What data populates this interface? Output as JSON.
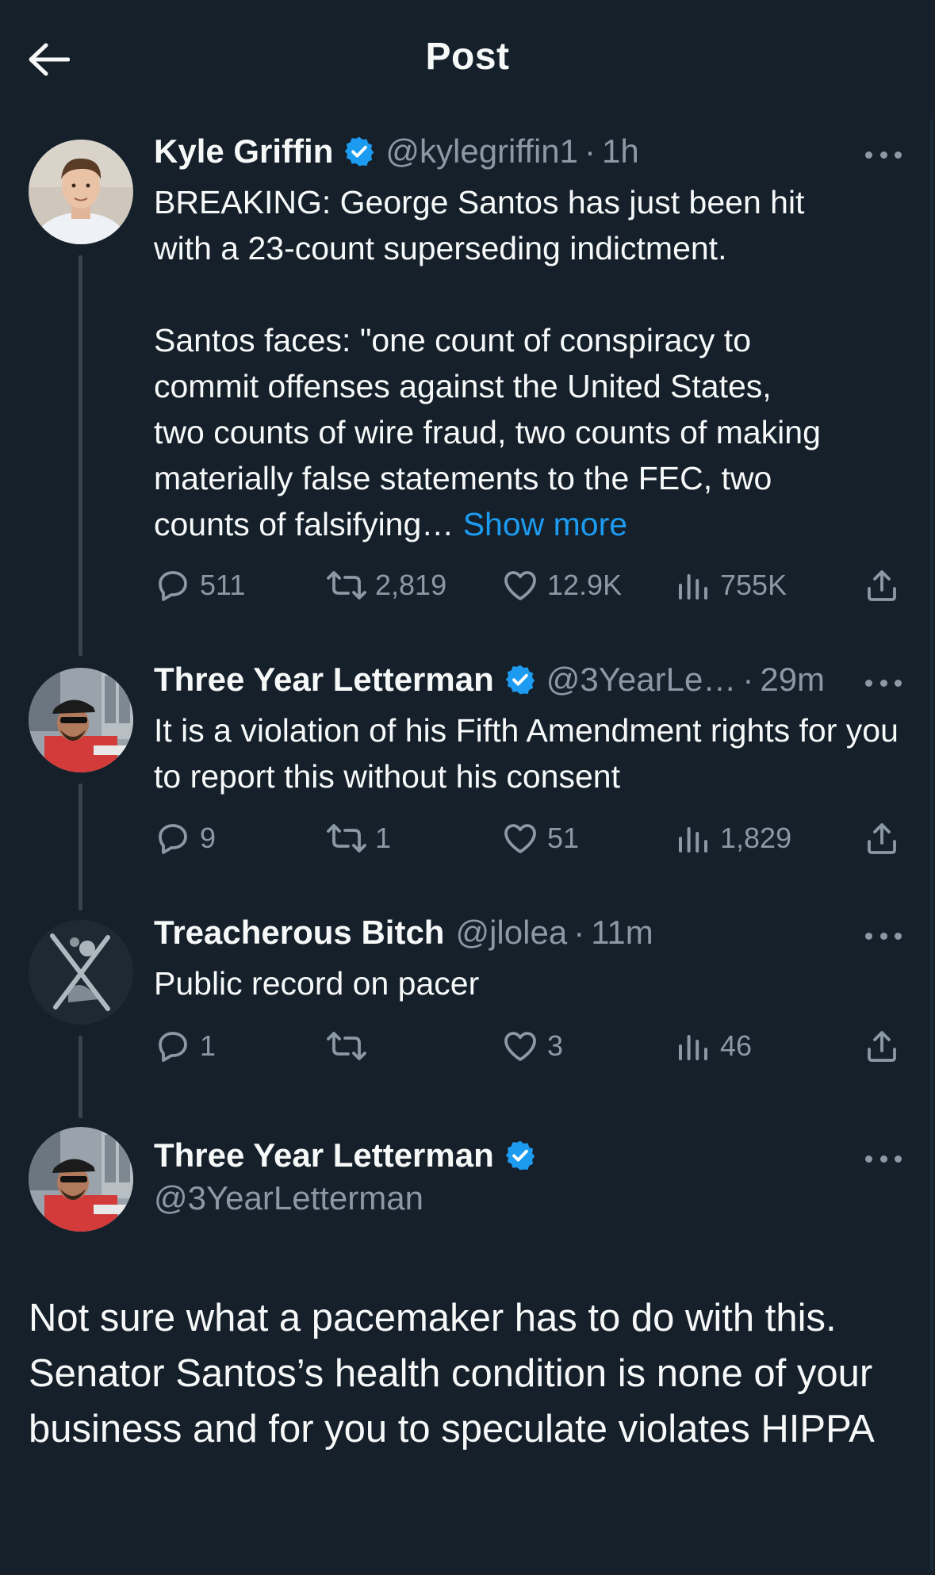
{
  "header": {
    "title": "Post"
  },
  "tweets": [
    {
      "name": "Kyle Griffin",
      "handle": "@kylegriffin1",
      "separator": "·",
      "time": "1h",
      "text": "BREAKING: George Santos has just been hit with a 23-count superseding indictment.\n\nSantos faces: \"one count of conspiracy to commit offenses against the United States, two counts of wire fraud, two counts of making materially false statements to the FEC, two counts of falsifying…",
      "show_more": " Show more",
      "replies": "511",
      "reposts": "2,819",
      "likes": "12.9K",
      "views": "755K"
    },
    {
      "name": "Three Year Letterman",
      "handle": "@3YearLe…",
      "separator": "·",
      "time": "29m",
      "text": "It is a violation of his Fifth Amendment rights for you to report this without his consent",
      "replies": "9",
      "reposts": "1",
      "likes": "51",
      "views": "1,829"
    },
    {
      "name": "Treacherous Bitch",
      "handle": "@jlolea",
      "separator": "·",
      "time": "11m",
      "text": "Public record on pacer",
      "replies": "1",
      "reposts": "",
      "likes": "3",
      "views": "46"
    }
  ],
  "main_post": {
    "name": "Three Year Letterman",
    "handle": "@3YearLetterman",
    "text": "Not sure what a pacemaker has to do with this. Senator Santos’s health condition is none of your business and for you to speculate violates HIPPA"
  },
  "colors": {
    "background": "#15202b",
    "text": "#f7f9f9",
    "secondary": "#8b98a5",
    "accent": "#1d9bf0",
    "thread_line": "#38444d"
  },
  "icons": [
    "back-arrow-icon",
    "verified-badge-icon",
    "more-icon",
    "reply-icon",
    "repost-icon",
    "like-icon",
    "views-icon",
    "share-icon"
  ]
}
